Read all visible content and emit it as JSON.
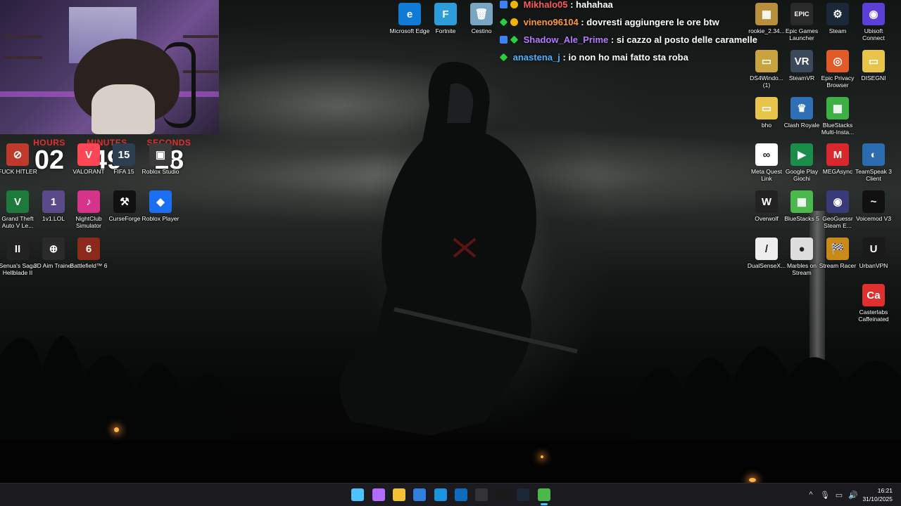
{
  "timer": {
    "hours_label": "HOURS",
    "hours": "02",
    "minutes_label": "MINUTES",
    "minutes": "49",
    "seconds_label": "SECONDS",
    "seconds": "18"
  },
  "chat": [
    {
      "user": "Mikhalo05",
      "user_color": "#ff5a5a",
      "message": "hahahaa"
    },
    {
      "user": "vineno96104",
      "user_color": "#ff9a2e",
      "message": "dovresti aggiungere le ore btw"
    },
    {
      "user": "Shadow_Ale_Prime",
      "user_color": "#b57bff",
      "message": "si cazzo al posto delle caramelle"
    },
    {
      "user": "anastena_j",
      "user_color": "#4fb0ff",
      "message": "io non ho mai fatto sta roba"
    }
  ],
  "desktop_icons_left": [
    {
      "label": "FUCK HITLER",
      "glyph": "⊘",
      "color": "#c0392b"
    },
    {
      "label": "VALORANT",
      "glyph": "V",
      "color": "#ff4655"
    },
    {
      "label": "FIFA 15",
      "glyph": "15",
      "color": "#2c3e50"
    },
    {
      "label": "Roblox Studio",
      "glyph": "▣",
      "color": "#3a3a3a"
    },
    {
      "label": "Grand Theft Auto V Le...",
      "glyph": "V",
      "color": "#1e7a3a"
    },
    {
      "label": "1v1.LOL",
      "glyph": "1",
      "color": "#5a4a8a"
    },
    {
      "label": "NightClub Simulator",
      "glyph": "♪",
      "color": "#d6338a"
    },
    {
      "label": "CurseForge",
      "glyph": "⚒",
      "color": "#111111"
    },
    {
      "label": "Roblox Player",
      "glyph": "◆",
      "color": "#1d6ff2"
    },
    {
      "label": "Senua's Saga Hellblade II",
      "glyph": "II",
      "color": "#222222"
    },
    {
      "label": "3D Aim Trainer",
      "glyph": "⊕",
      "color": "#2a2a2a"
    },
    {
      "label": "Battlefield™ 6",
      "glyph": "6",
      "color": "#8b2a1a"
    }
  ],
  "desktop_icons_top": [
    {
      "label": "Microsoft Edge",
      "glyph": "e",
      "color": "#0f7bd6"
    },
    {
      "label": "Fortnite",
      "glyph": "F",
      "color": "#2d9cdb"
    },
    {
      "label": "Cestino",
      "glyph": "🗑",
      "color": "#7aa6c2"
    }
  ],
  "desktop_icons_right": [
    {
      "label": "rookie_2.34...",
      "glyph": "▦",
      "color": "#b8903a"
    },
    {
      "label": "Epic Games Launcher",
      "glyph": "EPIC",
      "color": "#2a2a2a"
    },
    {
      "label": "Steam",
      "glyph": "⚙",
      "color": "#1b2838"
    },
    {
      "label": "Ubisoft Connect",
      "glyph": "◉",
      "color": "#5b3fd6"
    },
    {
      "label": "DS4Windo... (1)",
      "glyph": "▭",
      "color": "#c9a33e"
    },
    {
      "label": "SteamVR",
      "glyph": "VR",
      "color": "#3a4a5a"
    },
    {
      "label": "Epic Privacy Browser",
      "glyph": "◎",
      "color": "#e05a2a"
    },
    {
      "label": "DISEGNI",
      "glyph": "▭",
      "color": "#e8c44a"
    },
    {
      "label": "bho",
      "glyph": "▭",
      "color": "#e8c44a"
    },
    {
      "label": "Clash Royale",
      "glyph": "♛",
      "color": "#2f6fb5"
    },
    {
      "label": "BlueStacks Multi-Insta...",
      "glyph": "▦",
      "color": "#3cb043"
    },
    {
      "label": "Meta Quest Link",
      "glyph": "∞",
      "color": "#ffffff"
    },
    {
      "label": "Google Play Giochi",
      "glyph": "▶",
      "color": "#1a8d4a"
    },
    {
      "label": "MEGAsync",
      "glyph": "M",
      "color": "#d9272e"
    },
    {
      "label": "TeamSpeak 3 Client",
      "glyph": "◐",
      "color": "#2b6cb0"
    },
    {
      "label": "Overwolf",
      "glyph": "W",
      "color": "#222222"
    },
    {
      "label": "BlueStacks 5",
      "glyph": "▦",
      "color": "#4ab84a"
    },
    {
      "label": "GeoGuessr Steam E...",
      "glyph": "◉",
      "color": "#3a3a7a"
    },
    {
      "label": "Voicemod V3",
      "glyph": "~",
      "color": "#111111"
    },
    {
      "label": "DualSenseX...",
      "glyph": "/",
      "color": "#eeeeee"
    },
    {
      "label": "Marbles on Stream",
      "glyph": "●",
      "color": "#dddddd"
    },
    {
      "label": "Stream Racer",
      "glyph": "🏁",
      "color": "#c98a1a"
    },
    {
      "label": "UrbanVPN",
      "glyph": "U",
      "color": "#1a1a1a"
    },
    {
      "label": "Casterlabs Caffeinated",
      "glyph": "Ca",
      "color": "#e0302e"
    }
  ],
  "taskbar": {
    "apps": [
      {
        "name": "start-button",
        "color": "#4cc2ff"
      },
      {
        "name": "copilot-app",
        "color": "#b46cff"
      },
      {
        "name": "file-explorer-app",
        "color": "#f2c230"
      },
      {
        "name": "microsoft-store-app",
        "color": "#2f7fe0"
      },
      {
        "name": "edge-app",
        "color": "#1b93e0"
      },
      {
        "name": "outlook-app",
        "color": "#0f6cbd"
      },
      {
        "name": "obs-app",
        "color": "#333333"
      },
      {
        "name": "terminal-app",
        "color": "#1a1a1a"
      },
      {
        "name": "steam-app",
        "color": "#1b2838"
      },
      {
        "name": "bluestacks-app",
        "color": "#4ab84a"
      }
    ],
    "time": "16:21",
    "date": "31/10/2025"
  }
}
